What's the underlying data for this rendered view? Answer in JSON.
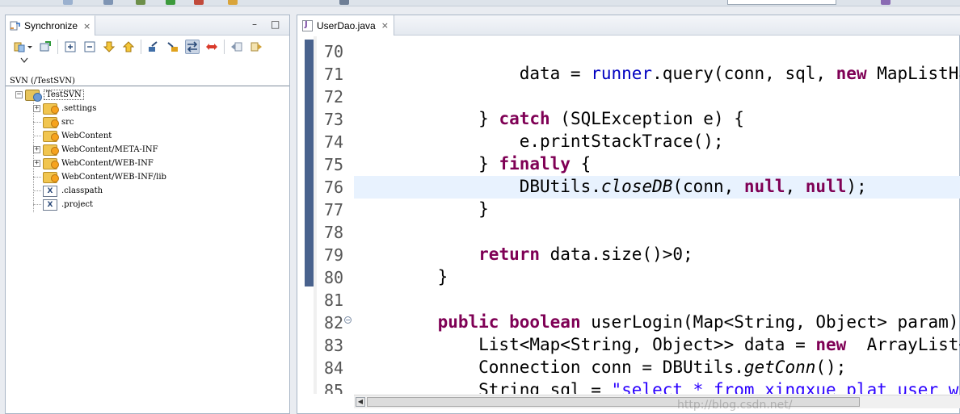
{
  "colors": {
    "keyword": "#7f0055",
    "field": "#0000c0",
    "string": "#2a00ff",
    "current_line": "#e8f2fe",
    "ruler_marker": "#49628d"
  },
  "synchronize_view": {
    "tab_title": "Synchronize",
    "tab_icon": "synchronize-icon",
    "close_label": "×",
    "minimize_label": "–",
    "maximize_label": "□",
    "toolbar_icons": [
      "change-set-icon",
      "pin-icon",
      "expand-all-icon",
      "collapse-all-icon",
      "next-change-icon",
      "previous-change-icon",
      "incoming-mode-icon",
      "outgoing-mode-icon",
      "incoming-outgoing-mode-icon",
      "conflicts-mode-icon",
      "back-icon",
      "forward-icon"
    ],
    "repository_label": "SVN (/TestSVN)",
    "tree": [
      {
        "label": "TestSVN",
        "level": 0,
        "expander": "−",
        "icon": "project-icon"
      },
      {
        "label": ".settings",
        "level": 1,
        "expander": "+",
        "icon": "folder-icon"
      },
      {
        "label": "src",
        "level": 1,
        "expander": "",
        "icon": "folder-icon"
      },
      {
        "label": "WebContent",
        "level": 1,
        "expander": "",
        "icon": "folder-icon"
      },
      {
        "label": "WebContent/META-INF",
        "level": 1,
        "expander": "+",
        "icon": "folder-icon"
      },
      {
        "label": "WebContent/WEB-INF",
        "level": 1,
        "expander": "+",
        "icon": "folder-icon"
      },
      {
        "label": "WebContent/WEB-INF/lib",
        "level": 1,
        "expander": "",
        "icon": "folder-icon"
      },
      {
        "label": ".classpath",
        "level": 1,
        "expander": "",
        "icon": "xml-file-icon"
      },
      {
        "label": ".project",
        "level": 1,
        "expander": "",
        "icon": "xml-file-icon"
      }
    ]
  },
  "editor": {
    "tab_title": "UserDao.java",
    "close_label": "×",
    "current_line": "76",
    "lines": [
      {
        "num": "70",
        "tokens": []
      },
      {
        "num": "71",
        "tokens": [
          {
            "t": "            data = ",
            "c": ""
          },
          {
            "t": "runner",
            "c": "fld"
          },
          {
            "t": ".query(conn, sql, ",
            "c": ""
          },
          {
            "t": "new",
            "c": "kw"
          },
          {
            "t": " MapListHandler",
            "c": ""
          }
        ]
      },
      {
        "num": "72",
        "tokens": []
      },
      {
        "num": "73",
        "tokens": [
          {
            "t": "        } ",
            "c": ""
          },
          {
            "t": "catch",
            "c": "kw"
          },
          {
            "t": " (SQLException e) {",
            "c": ""
          }
        ]
      },
      {
        "num": "74",
        "tokens": [
          {
            "t": "            e.printStackTrace();",
            "c": ""
          }
        ]
      },
      {
        "num": "75",
        "tokens": [
          {
            "t": "        } ",
            "c": ""
          },
          {
            "t": "finally",
            "c": "kw"
          },
          {
            "t": " {",
            "c": ""
          }
        ]
      },
      {
        "num": "76",
        "tokens": [
          {
            "t": "            DBUtils.",
            "c": ""
          },
          {
            "t": "closeDB",
            "c": "ital"
          },
          {
            "t": "(conn, ",
            "c": ""
          },
          {
            "t": "null",
            "c": "kw"
          },
          {
            "t": ", ",
            "c": ""
          },
          {
            "t": "null",
            "c": "kw"
          },
          {
            "t": ");",
            "c": ""
          }
        ]
      },
      {
        "num": "77",
        "tokens": [
          {
            "t": "        }",
            "c": ""
          }
        ]
      },
      {
        "num": "78",
        "tokens": []
      },
      {
        "num": "79",
        "tokens": [
          {
            "t": "        ",
            "c": ""
          },
          {
            "t": "return",
            "c": "kw"
          },
          {
            "t": " data.size()>0;",
            "c": ""
          }
        ]
      },
      {
        "num": "80",
        "tokens": [
          {
            "t": "    }",
            "c": ""
          }
        ]
      },
      {
        "num": "81",
        "tokens": []
      },
      {
        "num": "82",
        "tokens": [
          {
            "t": "    ",
            "c": ""
          },
          {
            "t": "public",
            "c": "kw"
          },
          {
            "t": " ",
            "c": ""
          },
          {
            "t": "boolean",
            "c": "kw"
          },
          {
            "t": " userLogin(Map<String, Object> param) {",
            "c": ""
          }
        ]
      },
      {
        "num": "83",
        "tokens": [
          {
            "t": "        List<Map<String, Object>> data = ",
            "c": ""
          },
          {
            "t": "new",
            "c": "kw"
          },
          {
            "t": "  ArrayList<Map<",
            "c": ""
          }
        ]
      },
      {
        "num": "84",
        "tokens": [
          {
            "t": "        Connection conn = DBUtils.",
            "c": ""
          },
          {
            "t": "getConn",
            "c": "ital"
          },
          {
            "t": "();",
            "c": ""
          }
        ]
      },
      {
        "num": "85",
        "tokens": [
          {
            "t": "        String sql = ",
            "c": ""
          },
          {
            "t": "\"select * from xingxue_plat_user where",
            "c": "str"
          }
        ]
      }
    ],
    "fold_marker_line": "82",
    "fold_marker_label": "−",
    "scroll_left_label": "◀",
    "watermark": "http://blog.csdn.net/"
  }
}
